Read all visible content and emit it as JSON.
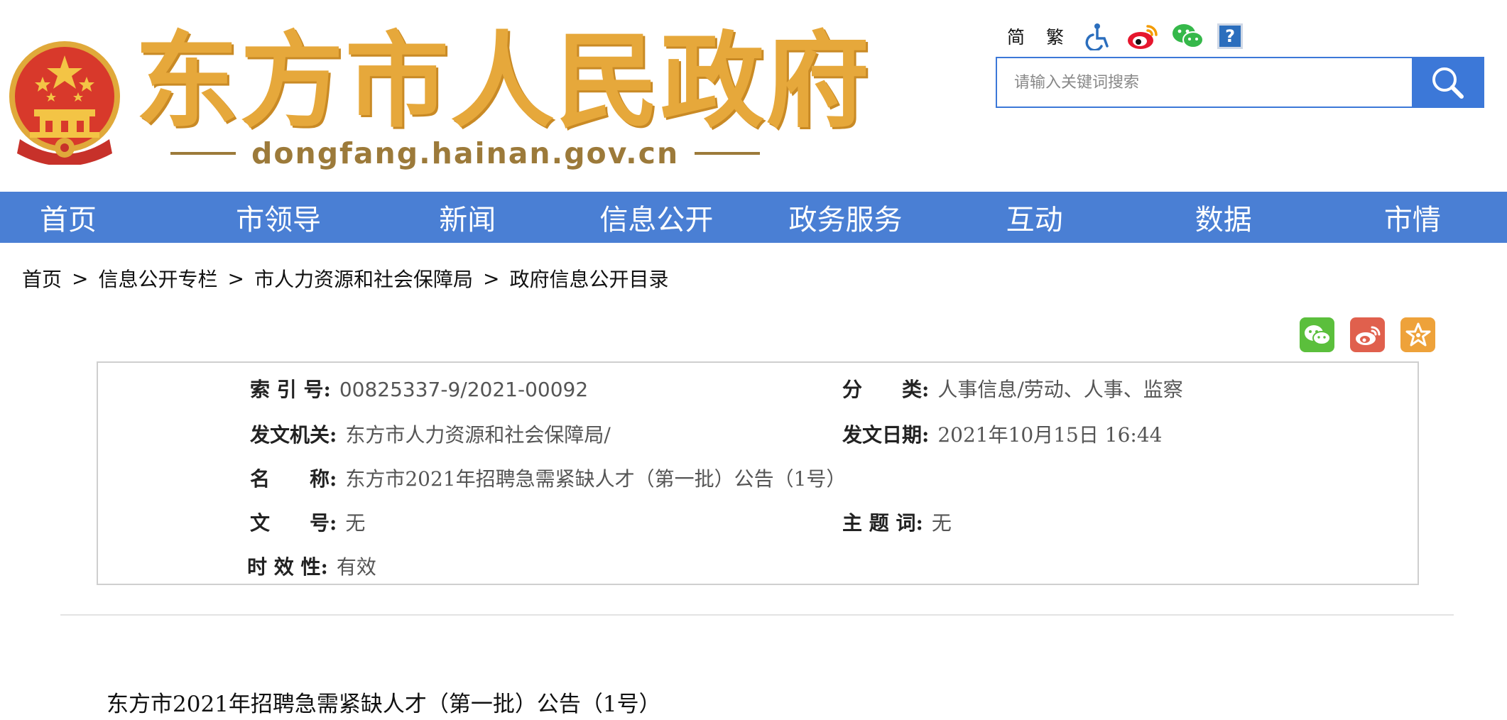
{
  "header": {
    "site_title": "东方市人民政府",
    "site_domain": "dongfang.hainan.gov.cn",
    "emblem_icon": "national-emblem-icon",
    "tools": {
      "simplified": "简",
      "traditional": "繁",
      "accessibility_icon": "accessibility-icon",
      "weibo_icon": "weibo-icon",
      "wechat_icon": "wechat-icon",
      "help_icon": "help-icon",
      "help_label": "?"
    },
    "search": {
      "placeholder": "请输入关键词搜索",
      "value": "",
      "button_icon": "search-icon"
    }
  },
  "nav": {
    "items": [
      "首页",
      "市领导",
      "新闻",
      "信息公开",
      "政务服务",
      "互动",
      "数据",
      "市情"
    ],
    "color": "#4a7fd4"
  },
  "breadcrumb": {
    "items": [
      "首页",
      "信息公开专栏",
      "市人力资源和社会保障局",
      "政府信息公开目录"
    ],
    "separator": ">"
  },
  "share": {
    "icons": [
      "wechat-share-icon",
      "weibo-share-icon",
      "favorite-icon"
    ],
    "colors": [
      "#5bbf3c",
      "#e0604d",
      "#eea23a"
    ]
  },
  "info": {
    "index_label": "索 引 号:",
    "index_value": "00825337-9/2021-00092",
    "category_label": "分　　类:",
    "category_value": "人事信息/劳动、人事、监察",
    "issuer_label": "发文机关:",
    "issuer_value": "东方市人力资源和社会保障局/",
    "date_label": "发文日期:",
    "date_value": "2021年10月15日 16:44",
    "name_label": "名　　称:",
    "name_value": "东方市2021年招聘急需紧缺人才（第一批）公告（1号）",
    "doc_no_label": "文　　号:",
    "doc_no_value": "无",
    "subject_label": "主 题 词:",
    "subject_value": "无",
    "validity_label": "时 效 性:",
    "validity_value": "有效"
  },
  "article": {
    "title": "东方市2021年招聘急需紧缺人才（第一批）公告（1号）"
  }
}
